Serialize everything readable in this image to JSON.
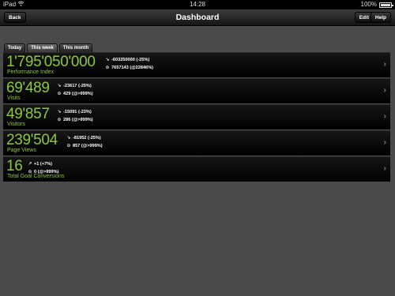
{
  "status_bar": {
    "device": "iPad",
    "time": "14:28",
    "battery": "100%"
  },
  "nav": {
    "title": "Dashboard",
    "back_label": "Back",
    "edit_label": "Edit",
    "help_label": "Help"
  },
  "tabs": [
    {
      "label": "Today"
    },
    {
      "label": "This week"
    },
    {
      "label": "This month"
    }
  ],
  "metrics": [
    {
      "value": "1'795'050'000",
      "label": "Performance Index",
      "trend_text": "-603250000 (-25%)",
      "compare_text": "7657143 (@22846%)"
    },
    {
      "value": "69'489",
      "label": "Visits",
      "trend_text": "-23617 (-25%)",
      "compare_text": "429 (@>999%)"
    },
    {
      "value": "49'857",
      "label": "Visitors",
      "trend_text": "-15091 (-23%)",
      "compare_text": "286 (@>999%)"
    },
    {
      "value": "239'504",
      "label": "Page Views",
      "trend_text": "-81952 (-25%)",
      "compare_text": "857 (@>999%)"
    },
    {
      "value": "16",
      "label": "Total Goal Conversions",
      "trend_text": "+1 (+7%)",
      "compare_text": "0 (@>999%)"
    }
  ]
}
